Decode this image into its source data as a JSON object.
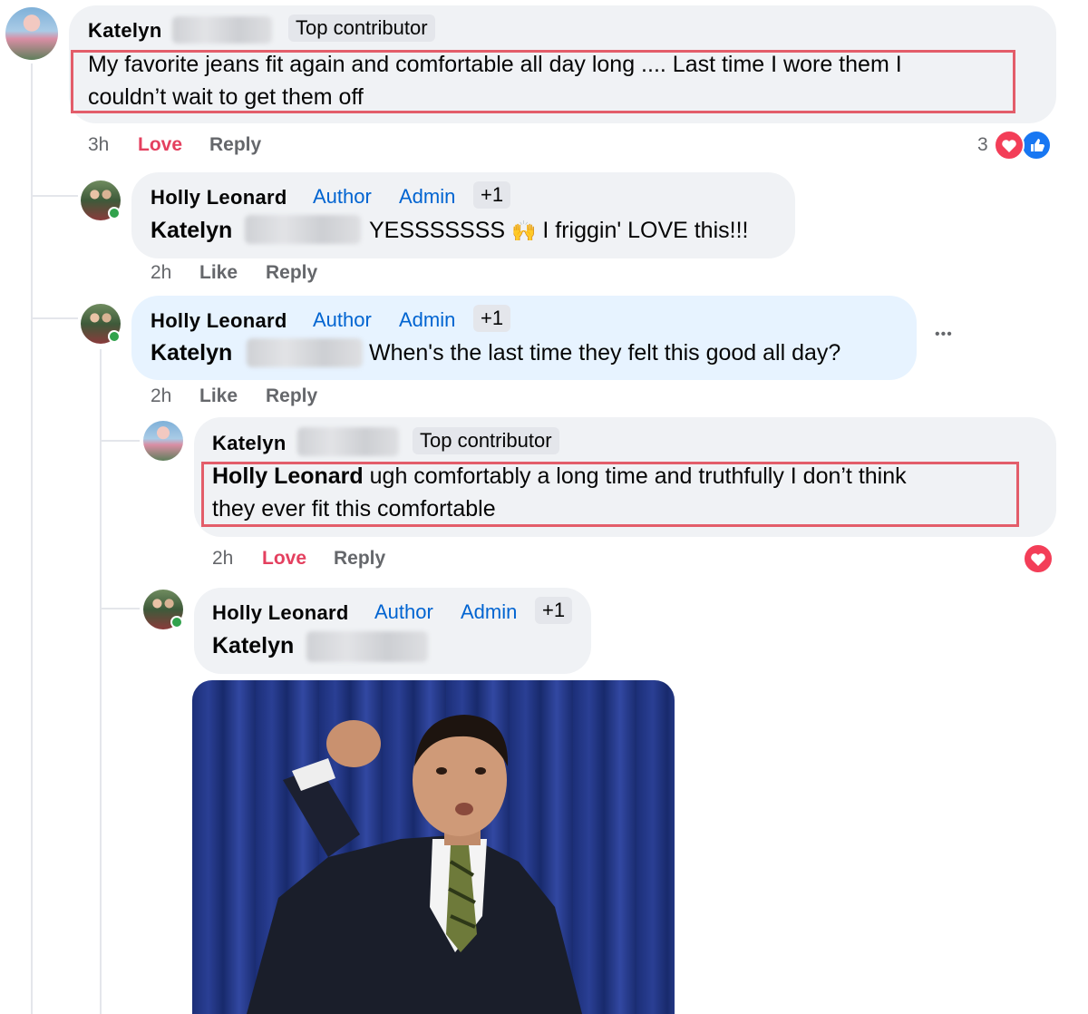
{
  "comment1": {
    "author": "Katelyn",
    "badge": "Top contributor",
    "text_line1": "My favorite jeans fit again and comfortable all day long .... Last time I wore them I",
    "text_line2": "couldn’t wait to get them off",
    "time": "3h",
    "reaction_action": "Love",
    "reply": "Reply",
    "reaction_count": "3"
  },
  "reply1": {
    "author": "Holly Leonard",
    "badge_author": "Author",
    "badge_admin": "Admin",
    "badge_plus": "+1",
    "mention": "Katelyn",
    "text": "YESSSSSSS",
    "emoji": "🙌",
    "text2": "I friggin' LOVE this!!!",
    "time": "2h",
    "like": "Like",
    "reply": "Reply"
  },
  "reply2": {
    "author": "Holly Leonard",
    "badge_author": "Author",
    "badge_admin": "Admin",
    "badge_plus": "+1",
    "mention": "Katelyn",
    "text": "When's the last time they felt this good all day?",
    "more": "•••",
    "time": "2h",
    "like": "Like",
    "reply": "Reply"
  },
  "reply3": {
    "author": "Katelyn",
    "badge": "Top contributor",
    "mention": "Holly Leonard",
    "text_line1": "ugh comfortably a long time and truthfully I don’t think",
    "text_line2": "they ever fit this comfortable",
    "time": "2h",
    "reaction_action": "Love",
    "reply": "Reply"
  },
  "reply4": {
    "author": "Holly Leonard",
    "badge_author": "Author",
    "badge_admin": "Admin",
    "badge_plus": "+1",
    "mention": "Katelyn"
  },
  "colors": {
    "accent_blue": "#0064d1",
    "love_red": "#e4405f",
    "highlight_box": "#e35d6a",
    "online_green": "#31a24c"
  }
}
